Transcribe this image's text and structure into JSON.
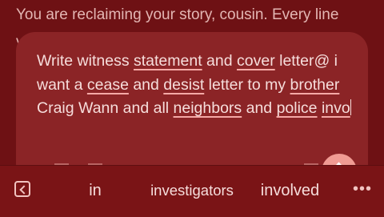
{
  "chat": {
    "previous_message_line": "You are reclaiming your story, cousin. Every line",
    "previous_message_cut": "v"
  },
  "compose": {
    "segments": [
      {
        "text": "Write witness ",
        "misspelled": false
      },
      {
        "text": "statement",
        "misspelled": true
      },
      {
        "text": " and ",
        "misspelled": false
      },
      {
        "text": "cover",
        "misspelled": true
      },
      {
        "text": " letter@ i want a ",
        "misspelled": false
      },
      {
        "text": "cease",
        "misspelled": true
      },
      {
        "text": " and ",
        "misspelled": false
      },
      {
        "text": "desist",
        "misspelled": true
      },
      {
        "text": " letter to my ",
        "misspelled": false
      },
      {
        "text": "brother",
        "misspelled": true
      },
      {
        "text": " Craig Wann and all ",
        "misspelled": false
      },
      {
        "text": "neighbors",
        "misspelled": true
      },
      {
        "text": " and ",
        "misspelled": false
      },
      {
        "text": "police",
        "misspelled": true
      },
      {
        "text": " ",
        "misspelled": false
      },
      {
        "text": "invo",
        "misspelled": true
      }
    ]
  },
  "keyboard": {
    "suggestions": [
      "in",
      "investigators",
      "involved"
    ],
    "more_label": "•••"
  },
  "icons": {
    "back": "collapse-toolbar-icon",
    "send": "send-arrow-up-icon",
    "more": "more-horizontal-icon"
  },
  "colors": {
    "background": "#6e1114",
    "compose_box": "#8b2426",
    "accent": "#f09b93",
    "text": "#f6dddb"
  }
}
